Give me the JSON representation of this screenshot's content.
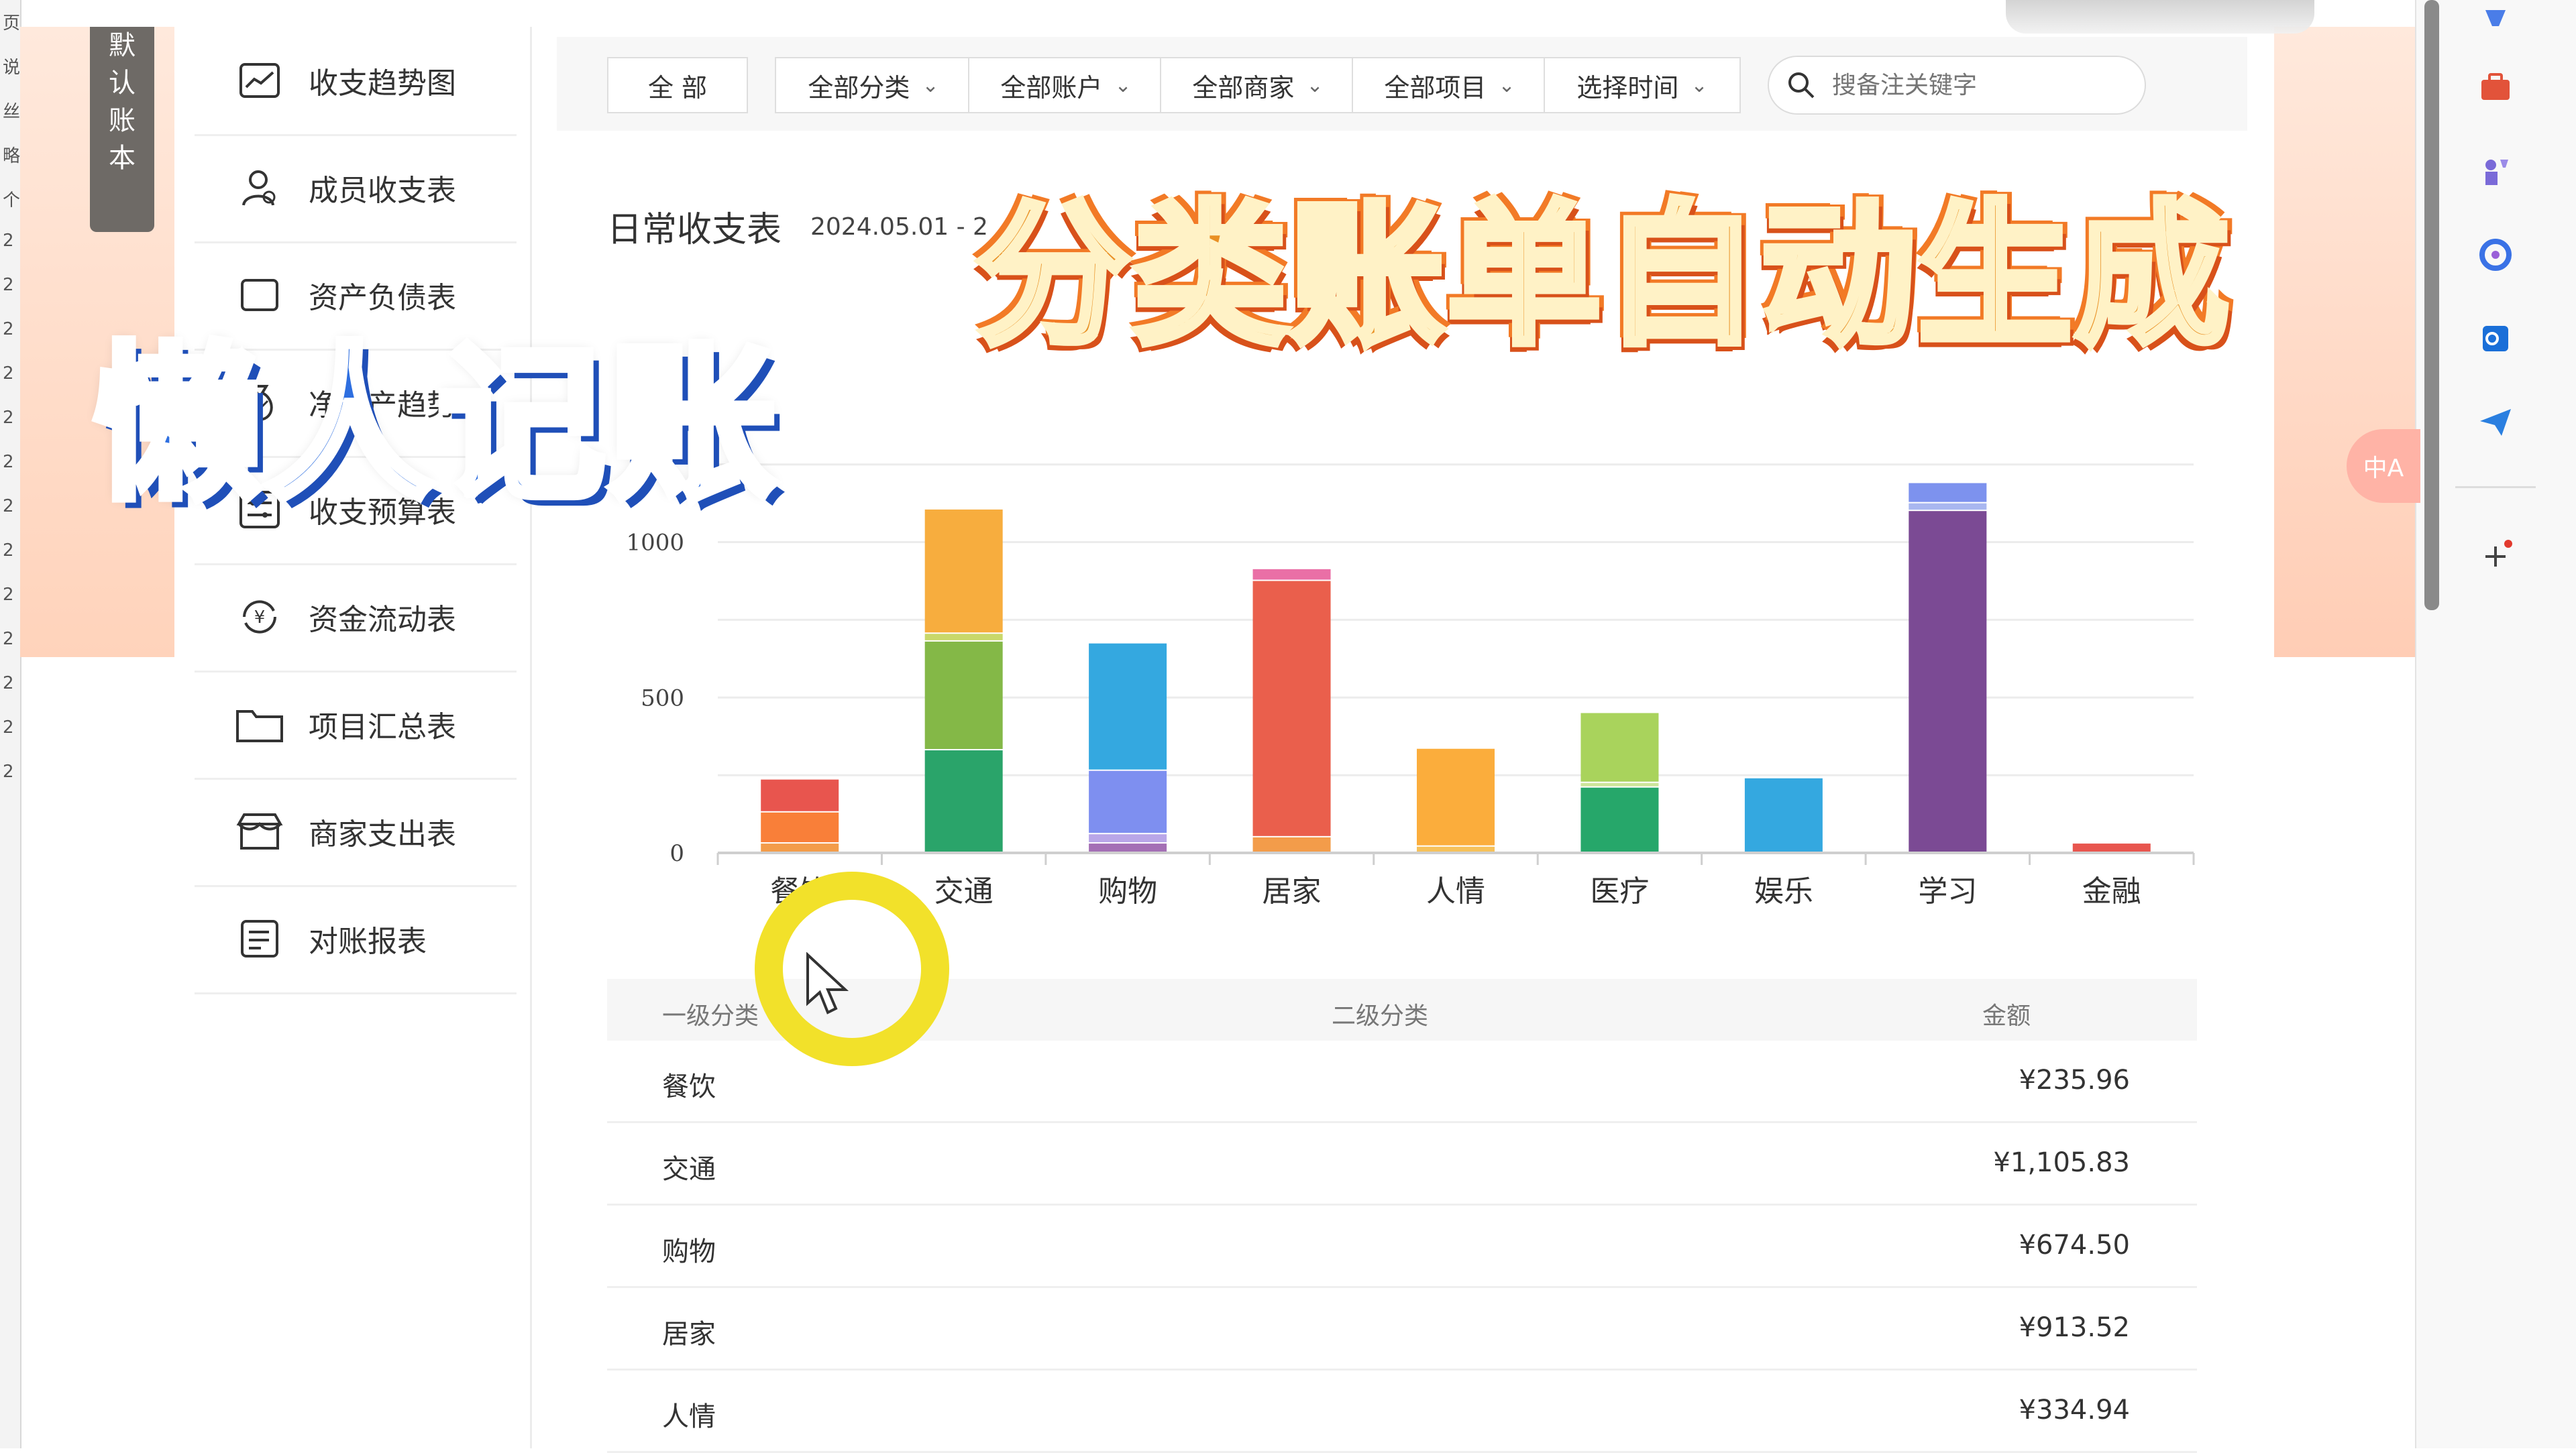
{
  "left_strip_chars": [
    "页",
    "说",
    "丝",
    "略",
    "个",
    "2",
    "2",
    "2",
    "2",
    "2",
    "2",
    "2",
    "2",
    "2",
    "2",
    "2",
    "2",
    "2"
  ],
  "ribbon": {
    "chars": [
      "默",
      "认",
      "账",
      "本"
    ]
  },
  "sidebar": {
    "items": [
      {
        "label": "收支趋势图",
        "icon": "line-chart-icon"
      },
      {
        "label": "成员收支表",
        "icon": "user-icon"
      },
      {
        "label": "资产负债表",
        "icon": "balance-icon"
      },
      {
        "label": "净资产趋势图",
        "icon": "money-bag-icon"
      },
      {
        "label": "收支预算表",
        "icon": "sliders-icon"
      },
      {
        "label": "资金流动表",
        "icon": "yen-flow-icon"
      },
      {
        "label": "项目汇总表",
        "icon": "folder-icon"
      },
      {
        "label": "商家支出表",
        "icon": "store-icon"
      },
      {
        "label": "对账报表",
        "icon": "report-icon"
      }
    ]
  },
  "toolbar": {
    "all": "全 部",
    "filters": [
      "全部分类",
      "全部账户",
      "全部商家",
      "全部项目",
      "选择时间"
    ],
    "search_placeholder": "搜备注关键字"
  },
  "report": {
    "title": "日常收支表",
    "date": "2024.05.01 - 2"
  },
  "overlay": {
    "left": "懒人记账",
    "right": "分类账单自动生成"
  },
  "chart_data": {
    "type": "bar",
    "stacked": true,
    "categories": [
      "餐饮",
      "交通",
      "购物",
      "居家",
      "人情",
      "医疗",
      "娱乐",
      "学习",
      "金融"
    ],
    "yticks": [
      0,
      500,
      1000
    ],
    "ylim": [
      0,
      1450
    ],
    "grid": true,
    "segments": [
      [
        {
          "v": 30,
          "c": "#f39c4a"
        },
        {
          "v": 100,
          "c": "#f97f39"
        },
        {
          "v": 106,
          "c": "#e8554e"
        }
      ],
      [
        {
          "v": 330,
          "c": "#2aa46a"
        },
        {
          "v": 350,
          "c": "#84b847"
        },
        {
          "v": 25,
          "c": "#c9d86a"
        },
        {
          "v": 400,
          "c": "#f7ad3e"
        }
      ],
      [
        {
          "v": 30,
          "c": "#a46fb5"
        },
        {
          "v": 30,
          "c": "#b9a6e8"
        },
        {
          "v": 204,
          "c": "#7e8ff0"
        },
        {
          "v": 410,
          "c": "#34a8e0"
        }
      ],
      [
        {
          "v": 50,
          "c": "#f39c4a"
        },
        {
          "v": 825,
          "c": "#ea5f4c"
        },
        {
          "v": 38,
          "c": "#ea6fa6"
        }
      ],
      [
        {
          "v": 20,
          "c": "#f6c15a"
        },
        {
          "v": 315,
          "c": "#fbad3c"
        }
      ],
      [
        {
          "v": 210,
          "c": "#26a76a"
        },
        {
          "v": 15,
          "c": "#cde59a"
        },
        {
          "v": 225,
          "c": "#a9d35c"
        }
      ],
      [
        {
          "v": 240,
          "c": "#34a8e0"
        }
      ],
      [
        {
          "v": 1100,
          "c": "#7b4a94"
        },
        {
          "v": 25,
          "c": "#a9b7f0"
        },
        {
          "v": 65,
          "c": "#7d92ee"
        }
      ],
      [
        {
          "v": 30,
          "c": "#e8554e"
        }
      ]
    ]
  },
  "table": {
    "headers": [
      "一级分类",
      "二级分类",
      "金额"
    ],
    "rows": [
      {
        "category": "餐饮",
        "amount": "¥235.96"
      },
      {
        "category": "交通",
        "amount": "¥1,105.83"
      },
      {
        "category": "购物",
        "amount": "¥674.50"
      },
      {
        "category": "居家",
        "amount": "¥913.52"
      },
      {
        "category": "人情",
        "amount": "¥334.94"
      }
    ]
  },
  "right_rail": {
    "translate_label": "中A"
  },
  "colors": {
    "accent_blue": "#2e6fe0",
    "accent_orange": "#e99024",
    "cursor_ring": "#f2e12a"
  }
}
